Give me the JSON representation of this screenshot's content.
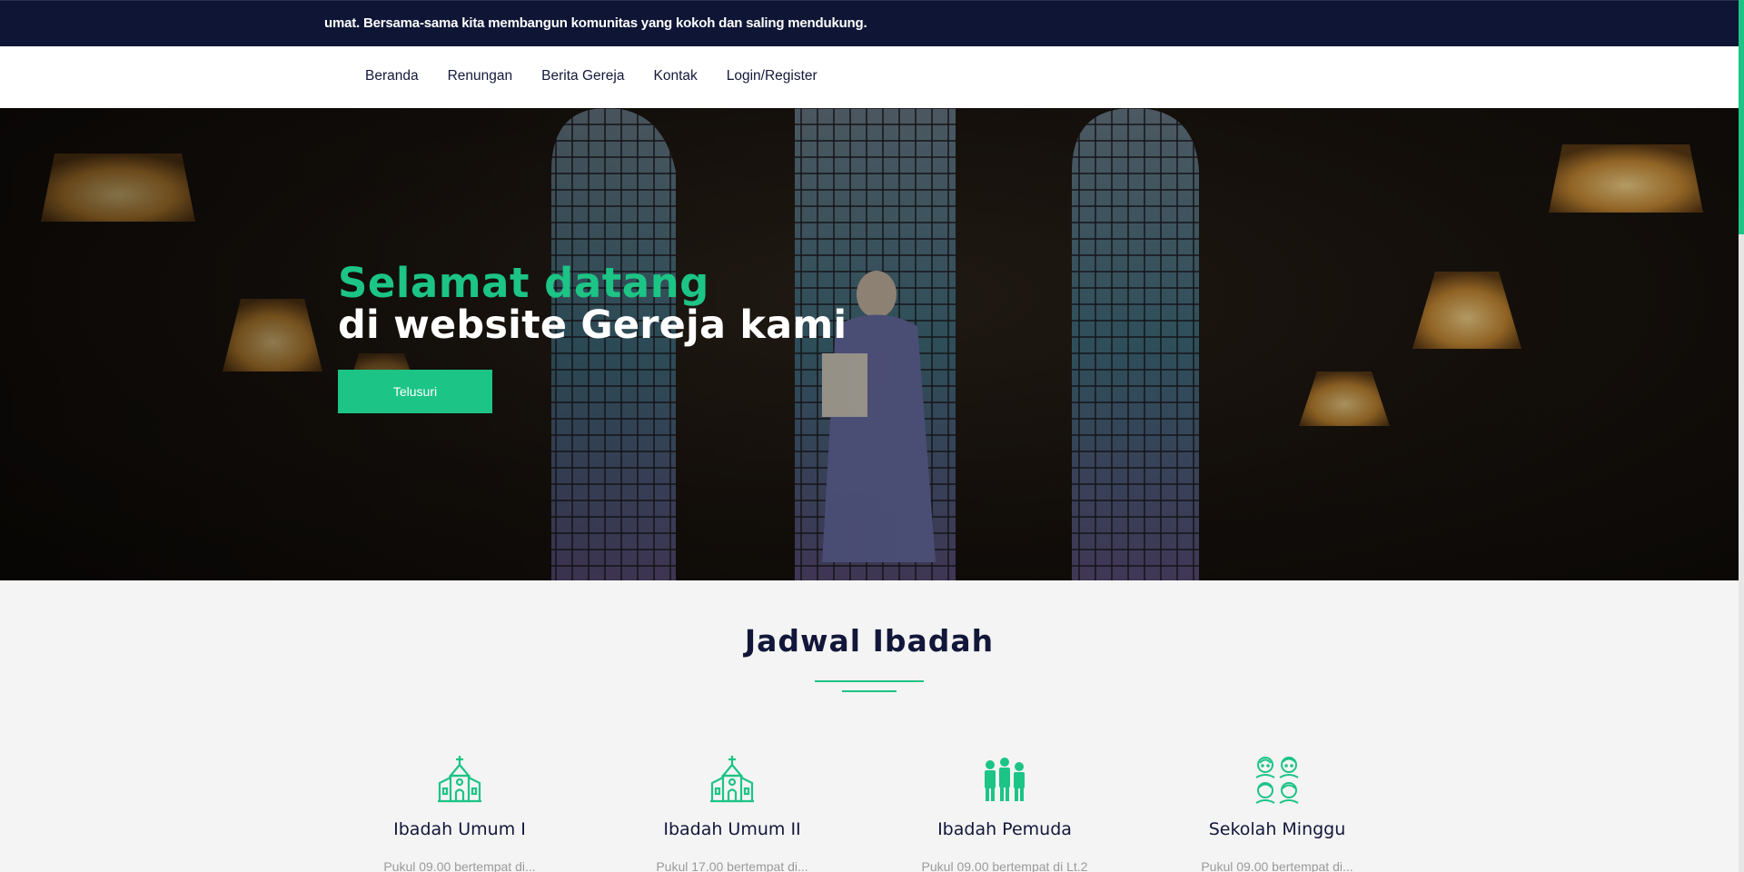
{
  "announcement": {
    "text": "umat. Bersama-sama kita membangun komunitas yang kokoh dan saling mendukung."
  },
  "nav": {
    "items": [
      {
        "label": "Beranda"
      },
      {
        "label": "Renungan"
      },
      {
        "label": "Berita Gereja"
      },
      {
        "label": "Kontak"
      },
      {
        "label": "Login/Register"
      }
    ]
  },
  "hero": {
    "title_line1": "Selamat datang",
    "title_line2": "di website Gereja kami",
    "button_label": "Telusuri"
  },
  "schedule": {
    "title": "Jadwal Ibadah",
    "services": [
      {
        "name": "Ibadah Umum I",
        "desc": "Pukul 09.00 bertempat di...",
        "icon": "church-icon"
      },
      {
        "name": "Ibadah Umum II",
        "desc": "Pukul 17.00 bertempat di...",
        "icon": "church-icon"
      },
      {
        "name": "Ibadah Pemuda",
        "desc": "Pukul 09.00 bertempat di Lt.2",
        "icon": "youth-group-icon"
      },
      {
        "name": "Sekolah Minggu",
        "desc": "Pukul 09.00 bertempat di...",
        "icon": "children-icon"
      }
    ]
  },
  "colors": {
    "accent": "#1cc486",
    "navy": "#0e1535",
    "text": "#12173a",
    "muted": "#9a9a9a",
    "background": "#f4f4f4"
  }
}
